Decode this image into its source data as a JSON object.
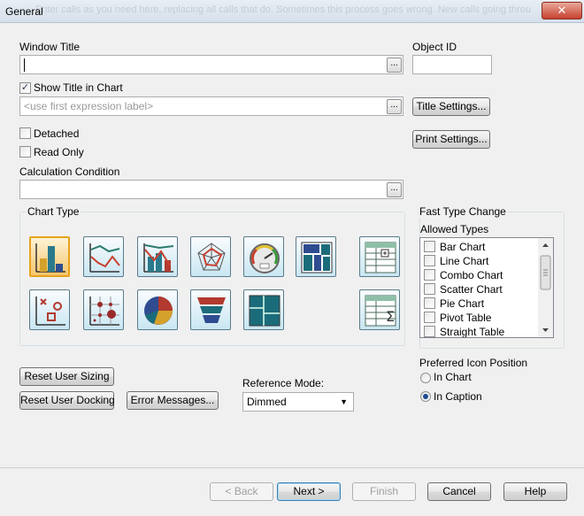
{
  "window": {
    "title": "General",
    "close_glyph": "✕",
    "background_text": "Enter calls as you need here, replacing all calls that do. Sometimes this process goes wrong. New calls going through now being redirected to each property. But if you have too much in your library it can continue with other functions"
  },
  "window_title": {
    "label": "Window Title",
    "value": ""
  },
  "object_id": {
    "label": "Object ID",
    "value": ""
  },
  "show_title": {
    "label": "Show Title in Chart",
    "checked": true,
    "placeholder": "<use first expression label>"
  },
  "buttons": {
    "browse": "...",
    "title_settings": "Title Settings...",
    "print_settings": "Print Settings...",
    "reset_user_sizing": "Reset User Sizing",
    "reset_user_docking": "Reset User Docking",
    "error_messages": "Error Messages...",
    "back": "< Back",
    "next": "Next >",
    "finish": "Finish",
    "cancel": "Cancel",
    "help": "Help"
  },
  "detached": {
    "label": "Detached",
    "checked": false
  },
  "read_only": {
    "label": "Read Only",
    "checked": false
  },
  "calc_condition": {
    "label": "Calculation Condition",
    "value": ""
  },
  "chart_type": {
    "label": "Chart Type",
    "selected": "bar-chart",
    "icons": [
      "bar-chart",
      "line-chart",
      "combo-chart",
      "radar-chart",
      "gauge-chart",
      "block-chart",
      "pivot-table",
      "scatter-chart",
      "grid-chart",
      "pie-chart",
      "funnel-chart",
      "mekko-chart",
      "straight-table"
    ]
  },
  "fast_type_change": {
    "label": "Fast Type Change",
    "allowed_types_label": "Allowed Types",
    "items": [
      {
        "label": "Bar Chart",
        "checked": false
      },
      {
        "label": "Line Chart",
        "checked": false
      },
      {
        "label": "Combo Chart",
        "checked": false
      },
      {
        "label": "Scatter Chart",
        "checked": false
      },
      {
        "label": "Pie Chart",
        "checked": false
      },
      {
        "label": "Pivot Table",
        "checked": false
      },
      {
        "label": "Straight Table",
        "checked": false
      }
    ],
    "preferred_icon_label": "Preferred Icon Position",
    "in_chart": "In Chart",
    "in_caption": "In Caption",
    "selected_position": "In Caption"
  },
  "reference_mode": {
    "label": "Reference Mode:",
    "value": "Dimmed",
    "arrow": "▼"
  },
  "colors": {
    "accent": "#3c7fb1",
    "selected_icon": "#e7a21d"
  }
}
